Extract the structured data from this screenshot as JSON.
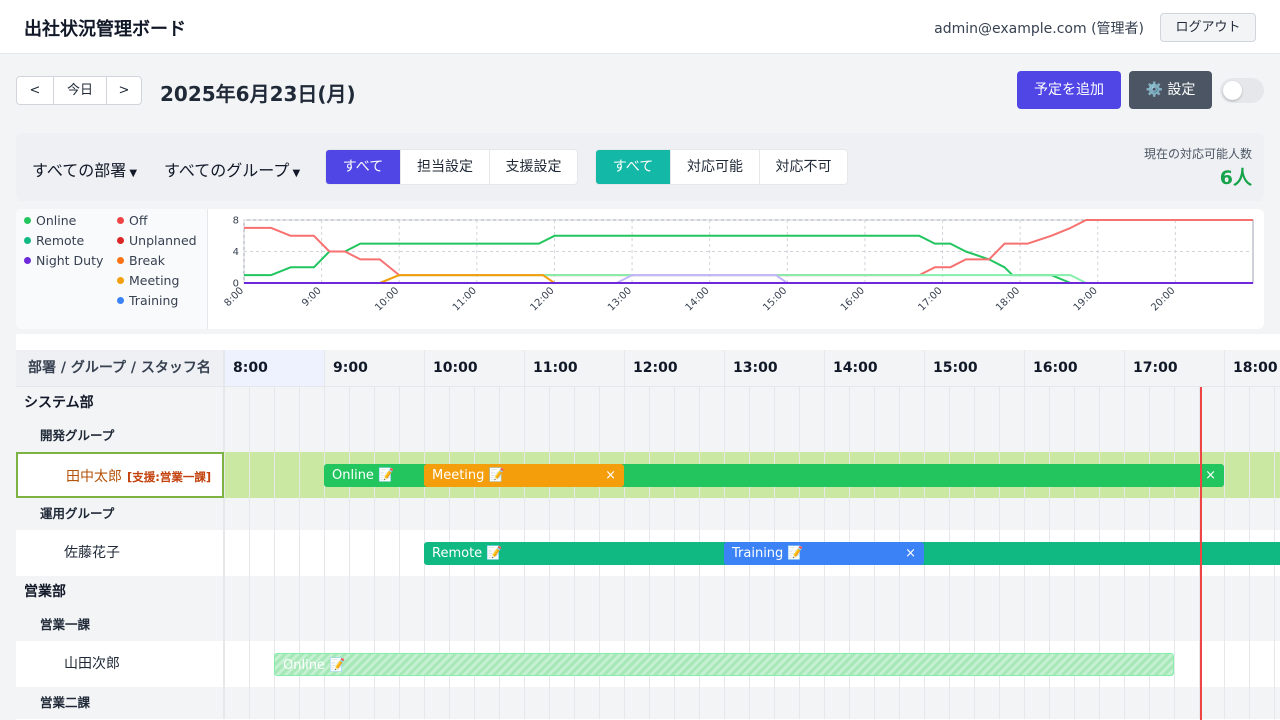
{
  "header": {
    "title": "出社状況管理ボード",
    "user": "admin@example.com (管理者)",
    "logout_label": "ログアウト"
  },
  "toolbar": {
    "prev_label": "<",
    "today_label": "今日",
    "next_label": ">",
    "date": "2025年6月23日(月)",
    "add_label": "予定を追加",
    "settings_label": "⚙️ 設定",
    "toggle_on": false
  },
  "filters": {
    "department": "すべての部署",
    "group": "すべてのグループ",
    "assignment_tabs": [
      "すべて",
      "担当設定",
      "支援設定"
    ],
    "assignment_selected": "すべて",
    "availability_tabs": [
      "すべて",
      "対応可能",
      "対応不可"
    ],
    "availability_selected": "すべて",
    "available_label": "現在の対応可能人数",
    "available_count": "6人"
  },
  "chart_data": {
    "type": "line",
    "x_ticks": [
      "8:00",
      "9:00",
      "10:00",
      "11:00",
      "12:00",
      "13:00",
      "14:00",
      "15:00",
      "16:00",
      "17:00",
      "18:00",
      "19:00",
      "20:00"
    ],
    "y_ticks": [
      0,
      4,
      8
    ],
    "ylim": [
      0,
      8
    ],
    "xlim": [
      8,
      21
    ],
    "grid": true,
    "legend_position": "left",
    "legend": [
      {
        "name": "Online",
        "color": "#22c55e"
      },
      {
        "name": "Off",
        "color": "#ef4444"
      },
      {
        "name": "Remote",
        "color": "#10b981"
      },
      {
        "name": "Unplanned",
        "color": "#dc2626"
      },
      {
        "name": "Night Duty",
        "color": "#6d28d9"
      },
      {
        "name": "Break",
        "color": "#f97316"
      },
      {
        "name": "Meeting",
        "color": "#f59e0b"
      },
      {
        "name": "Training",
        "color": "#3b82f6"
      }
    ],
    "series": [
      {
        "name": "Online",
        "color": "#22c55e",
        "points": [
          [
            8,
            1
          ],
          [
            8.35,
            1
          ],
          [
            8.6,
            2
          ],
          [
            8.9,
            2
          ],
          [
            9.1,
            4
          ],
          [
            9.3,
            4
          ],
          [
            9.5,
            5
          ],
          [
            11.8,
            5
          ],
          [
            12,
            6
          ],
          [
            16.7,
            6
          ],
          [
            16.9,
            5
          ],
          [
            17.1,
            5
          ],
          [
            17.3,
            4
          ],
          [
            17.6,
            3
          ],
          [
            17.8,
            2
          ],
          [
            17.9,
            1
          ],
          [
            18.4,
            1
          ],
          [
            18.65,
            0
          ],
          [
            21,
            0
          ]
        ]
      },
      {
        "name": "Off",
        "color": "#f87171",
        "points": [
          [
            8,
            7
          ],
          [
            8.35,
            7
          ],
          [
            8.6,
            6
          ],
          [
            8.9,
            6
          ],
          [
            9.1,
            4
          ],
          [
            9.3,
            4
          ],
          [
            9.5,
            3
          ],
          [
            9.75,
            3
          ],
          [
            10,
            1
          ],
          [
            16.7,
            1
          ],
          [
            16.9,
            2
          ],
          [
            17.1,
            2
          ],
          [
            17.3,
            3
          ],
          [
            17.6,
            3
          ],
          [
            17.8,
            5
          ],
          [
            18.1,
            5
          ],
          [
            18.4,
            6
          ],
          [
            18.65,
            7
          ],
          [
            18.85,
            8
          ],
          [
            21,
            8
          ]
        ]
      },
      {
        "name": "Remote",
        "color": "#86efac",
        "points": [
          [
            8,
            0
          ],
          [
            9.75,
            0
          ],
          [
            10,
            1
          ],
          [
            18.65,
            1
          ],
          [
            18.85,
            0
          ],
          [
            21,
            0
          ]
        ]
      },
      {
        "name": "Meeting",
        "color": "#f59e0b",
        "points": [
          [
            8,
            0
          ],
          [
            9.75,
            0
          ],
          [
            10,
            1
          ],
          [
            11.85,
            1
          ],
          [
            12,
            0
          ],
          [
            21,
            0
          ]
        ]
      },
      {
        "name": "Training",
        "color": "#c4b5fd",
        "points": [
          [
            8,
            0
          ],
          [
            12.8,
            0
          ],
          [
            13,
            1
          ],
          [
            14.85,
            1
          ],
          [
            15,
            0
          ],
          [
            21,
            0
          ]
        ]
      },
      {
        "name": "Night Duty",
        "color": "#6d28d9",
        "points": [
          [
            8,
            0
          ],
          [
            21,
            0
          ]
        ]
      }
    ]
  },
  "timeline": {
    "header_label": "部署 / グループ / スタッフ名",
    "hours": [
      "8:00",
      "9:00",
      "10:00",
      "11:00",
      "12:00",
      "13:00",
      "14:00",
      "15:00",
      "16:00",
      "17:00",
      "18:00"
    ],
    "rows": [
      {
        "kind": "dept",
        "label": "システム部"
      },
      {
        "kind": "group",
        "label": "開発グループ"
      },
      {
        "kind": "staff",
        "label": "田中太郎",
        "tag": "[支援:営業一課]",
        "selected": true
      },
      {
        "kind": "group",
        "label": "運用グループ"
      },
      {
        "kind": "staff",
        "label": "佐藤花子"
      },
      {
        "kind": "dept",
        "label": "営業部"
      },
      {
        "kind": "group",
        "label": "営業一課"
      },
      {
        "kind": "staff",
        "label": "山田次郎"
      },
      {
        "kind": "group",
        "label": "営業二課"
      }
    ],
    "bars": [
      {
        "row": 2,
        "label": "Online 📝",
        "start": "9:00",
        "end": "18:00",
        "color": "#22c55e",
        "close": "×"
      },
      {
        "row": 2,
        "label": "Meeting 📝",
        "start": "10:00",
        "end": "12:00",
        "color": "#f59e0b",
        "close": "×"
      },
      {
        "row": 4,
        "label": "Remote 📝",
        "start": "10:00",
        "end": "19:00",
        "color": "#10b981"
      },
      {
        "row": 4,
        "label": "Training 📝",
        "start": "13:00",
        "end": "15:00",
        "color": "#3b82f6",
        "close": "×"
      },
      {
        "row": 7,
        "label": "Online 📝",
        "start": "8:30",
        "end": "17:30",
        "color": "#86efac",
        "pending": true
      }
    ]
  }
}
